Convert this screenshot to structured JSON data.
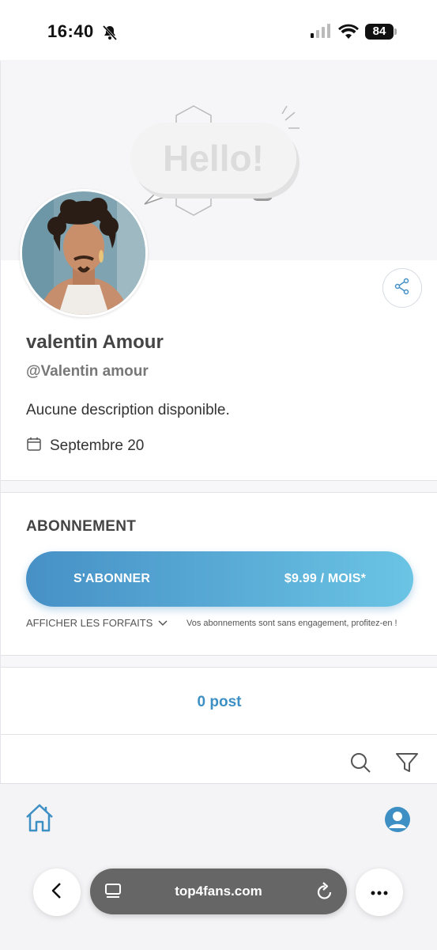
{
  "status_bar": {
    "time": "16:40",
    "battery": "84"
  },
  "banner": {
    "greeting": "Hello!"
  },
  "profile": {
    "name": "valentin Amour",
    "handle": "@Valentin amour",
    "description": "Aucune description disponible.",
    "joined": "Septembre 20"
  },
  "subscription": {
    "title": "ABONNEMENT",
    "subscribe_label": "S'ABONNER",
    "price": "$9.99 / MOIS*",
    "plans_link": "AFFICHER LES FORFAITS",
    "note": "Vos abonnements sont sans engagement, profitez-en !"
  },
  "posts": {
    "count_label": "0 post"
  },
  "browser": {
    "url": "top4fans.com"
  },
  "colors": {
    "accent": "#3d8fc4",
    "gradient_start": "#4690c6",
    "gradient_end": "#6ac4e4"
  }
}
